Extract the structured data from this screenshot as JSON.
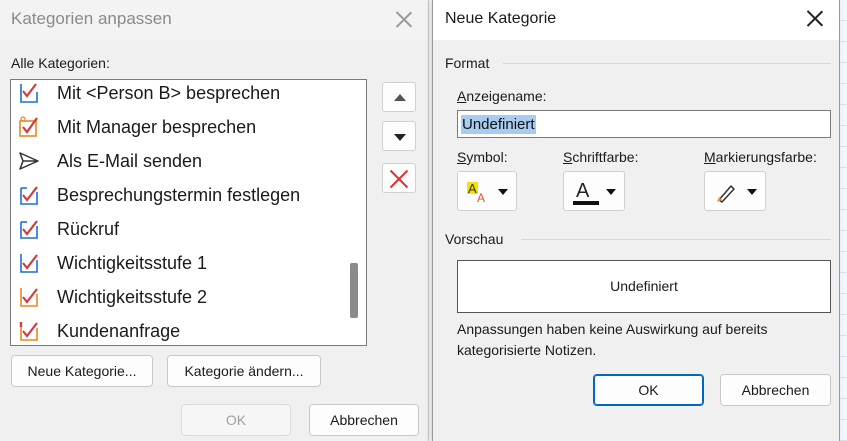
{
  "left_dialog": {
    "title": "Kategorien anpassen",
    "all_categories_label": "Alle Kategorien:",
    "items": [
      {
        "label": "Mit <Person B> besprechen",
        "icon": "task-red-check-blue-box-icon"
      },
      {
        "label": "Mit Manager besprechen",
        "icon": "task-red-check-orange-box-icon"
      },
      {
        "label": "Als E-Mail senden",
        "icon": "send-arrow-icon"
      },
      {
        "label": "Besprechungstermin festlegen",
        "icon": "task-red-check-blue-box-icon"
      },
      {
        "label": "Rückruf",
        "icon": "task-red-check-blue-box-icon"
      },
      {
        "label": "Wichtigkeitsstufe 1",
        "icon": "task-red-check-blue-box-icon"
      },
      {
        "label": "Wichtigkeitsstufe 2",
        "icon": "task-red-check-orange-box-icon"
      },
      {
        "label": "Kundenanfrage",
        "icon": "task-red-check-orange-box-icon"
      }
    ],
    "buttons": {
      "new_category": "Neue Kategorie...",
      "change_category": "Kategorie ändern...",
      "ok": "OK",
      "cancel": "Abbrechen"
    }
  },
  "right_dialog": {
    "title": "Neue Kategorie",
    "format_label": "Format",
    "display_name_label_u": "A",
    "display_name_label_rest": "nzeigename:",
    "display_name_value": "Undefiniert",
    "symbol_label_u": "S",
    "symbol_label_rest": "ymbol:",
    "font_color_label_u": "S",
    "font_color_label_rest": "chriftfarbe:",
    "highlight_label_u": "M",
    "highlight_label_rest": "arkierungsfarbe:",
    "preview_label": "Vorschau",
    "preview_text": "Undefiniert",
    "note": "Anpassungen haben keine Auswirkung auf bereits kategorisierte Notizen.",
    "ok": "OK",
    "cancel": "Abbrechen"
  },
  "colors": {
    "accent": "#0067c0",
    "selection": "#a8cbf0",
    "check_red": "#d33b3b",
    "box_blue": "#1f6fd1",
    "box_orange": "#e8891f"
  }
}
